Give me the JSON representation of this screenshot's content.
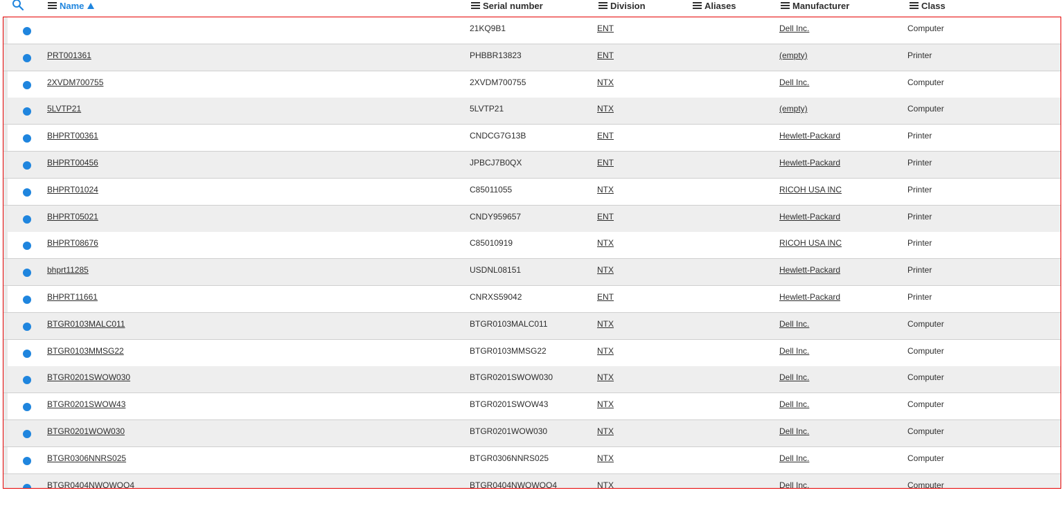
{
  "header": {
    "columns": [
      {
        "label": "Name",
        "sorted": "ascending"
      },
      {
        "label": "Serial number"
      },
      {
        "label": "Division"
      },
      {
        "label": "Aliases"
      },
      {
        "label": "Manufacturer"
      },
      {
        "label": "Class"
      }
    ]
  },
  "colors": {
    "accent": "#1f85de",
    "frame": "#e60000",
    "alt_row": "#eeeeee"
  },
  "rows": [
    {
      "name": "",
      "serial": "21KQ9B1",
      "division": "ENT",
      "manufacturer": "Dell Inc.",
      "class": "Computer"
    },
    {
      "name": "PRT001361",
      "serial": "PHBBR13823",
      "division": "ENT",
      "manufacturer": "(empty)",
      "class": "Printer"
    },
    {
      "name": "2XVDM700755",
      "serial": "2XVDM700755",
      "division": "NTX",
      "manufacturer": "Dell Inc.",
      "class": "Computer"
    },
    {
      "name": "5LVTP21",
      "serial": "5LVTP21",
      "division": "NTX",
      "manufacturer": "(empty)",
      "class": "Computer"
    },
    {
      "name": "BHPRT00361",
      "serial": "CNDCG7G13B",
      "division": "ENT",
      "manufacturer": "Hewlett-Packard",
      "class": "Printer"
    },
    {
      "name": "BHPRT00456",
      "serial": "JPBCJ7B0QX",
      "division": "ENT",
      "manufacturer": "Hewlett-Packard",
      "class": "Printer"
    },
    {
      "name": "BHPRT01024",
      "serial": "C85011055",
      "division": "NTX",
      "manufacturer": "RICOH USA INC",
      "class": "Printer"
    },
    {
      "name": "BHPRT05021",
      "serial": "CNDY959657",
      "division": "ENT",
      "manufacturer": "Hewlett-Packard",
      "class": "Printer"
    },
    {
      "name": "BHPRT08676",
      "serial": "C85010919",
      "division": "NTX",
      "manufacturer": "RICOH USA INC",
      "class": "Printer"
    },
    {
      "name": "bhprt11285",
      "serial": "USDNL08151",
      "division": "NTX",
      "manufacturer": "Hewlett-Packard",
      "class": "Printer"
    },
    {
      "name": "BHPRT11661",
      "serial": "CNRXS59042",
      "division": "ENT",
      "manufacturer": "Hewlett-Packard",
      "class": "Printer"
    },
    {
      "name": "BTGR0103MALC011",
      "serial": "BTGR0103MALC011",
      "division": "NTX",
      "manufacturer": "Dell Inc.",
      "class": "Computer"
    },
    {
      "name": "BTGR0103MMSG22",
      "serial": "BTGR0103MMSG22",
      "division": "NTX",
      "manufacturer": "Dell Inc.",
      "class": "Computer"
    },
    {
      "name": "BTGR0201SWOW030",
      "serial": "BTGR0201SWOW030",
      "division": "NTX",
      "manufacturer": "Dell Inc.",
      "class": "Computer"
    },
    {
      "name": "BTGR0201SWOW43",
      "serial": "BTGR0201SWOW43",
      "division": "NTX",
      "manufacturer": "Dell Inc.",
      "class": "Computer"
    },
    {
      "name": "BTGR0201WOW030",
      "serial": "BTGR0201WOW030",
      "division": "NTX",
      "manufacturer": "Dell Inc.",
      "class": "Computer"
    },
    {
      "name": "BTGR0306NNRS025",
      "serial": "BTGR0306NNRS025",
      "division": "NTX",
      "manufacturer": "Dell Inc.",
      "class": "Computer"
    },
    {
      "name": "BTGR0404NWOWOO4",
      "serial": "BTGR0404NWOWOO4",
      "division": "NTX",
      "manufacturer": "Dell Inc.",
      "class": "Computer"
    }
  ]
}
